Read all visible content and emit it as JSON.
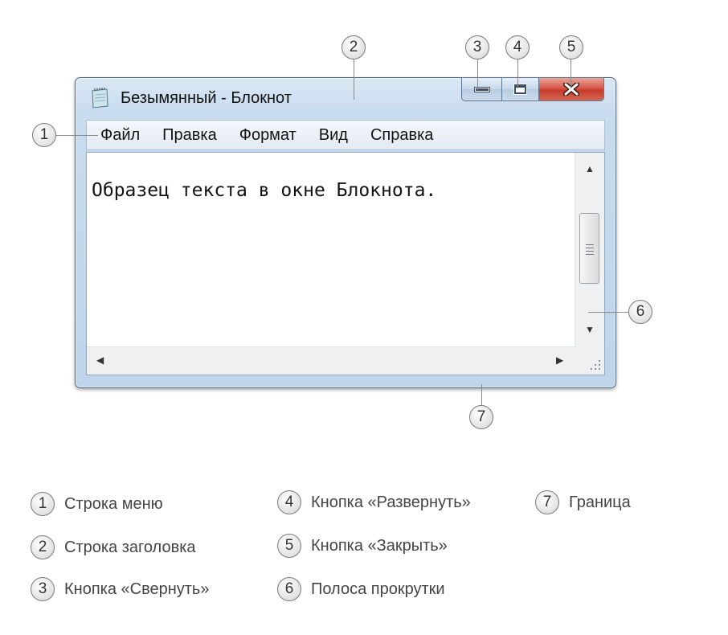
{
  "window": {
    "title": "Безымянный - Блокнот",
    "menu": [
      "Файл",
      "Правка",
      "Формат",
      "Вид",
      "Справка"
    ],
    "content_text": "Образец текста в окне Блокнота.",
    "icons": {
      "app": "notepad-icon",
      "minimize": "minimize-icon",
      "maximize": "maximize-icon",
      "close": "close-icon",
      "scroll_up": "scroll-up-arrow-icon",
      "scroll_down": "scroll-down-arrow-icon",
      "scroll_left": "scroll-left-arrow-icon",
      "scroll_right": "scroll-right-arrow-icon"
    },
    "colors": {
      "close_button": "#c63a2c",
      "frame": "#c9dcef"
    }
  },
  "callouts": [
    "1",
    "2",
    "3",
    "4",
    "5",
    "6",
    "7"
  ],
  "legend": [
    {
      "num": "1",
      "text": "Строка меню"
    },
    {
      "num": "2",
      "text": "Строка заголовка"
    },
    {
      "num": "3",
      "text": "Кнопка «Свернуть»"
    },
    {
      "num": "4",
      "text": "Кнопка «Развернуть»"
    },
    {
      "num": "5",
      "text": "Кнопка «Закрыть»"
    },
    {
      "num": "6",
      "text": "Полоса прокрутки"
    },
    {
      "num": "7",
      "text": "Граница"
    }
  ]
}
